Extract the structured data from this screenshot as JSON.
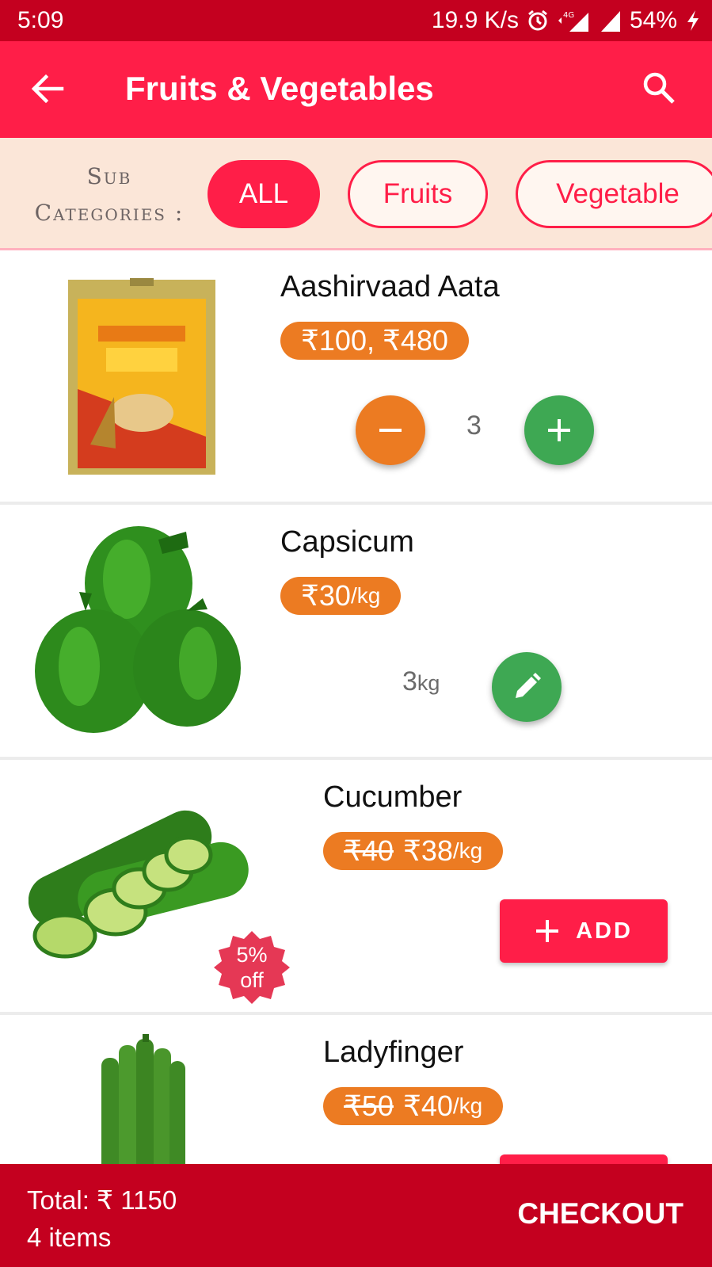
{
  "status": {
    "time": "5:09",
    "network_speed": "19.9 K/s",
    "network_type": "4G",
    "battery": "54%"
  },
  "app_bar": {
    "title": "Fruits & Vegetables",
    "back_icon": "arrow-back-icon",
    "search_icon": "search-icon"
  },
  "subcategories": {
    "label_line1": "Sub",
    "label_line2": "Categories :",
    "chips": [
      "ALL",
      "Fruits",
      "Vegetable"
    ],
    "selected": "ALL"
  },
  "products": [
    {
      "name": "Aashirvaad Aata",
      "price": "₹100, ₹480",
      "quantity": "3",
      "image": "atta-package-image"
    },
    {
      "name": "Capsicum",
      "price": "₹30",
      "unit": "/kg",
      "quantity": "3",
      "quantity_unit": "kg",
      "image": "capsicum-image"
    },
    {
      "name": "Cucumber",
      "old_price": "₹40",
      "price": "₹38",
      "unit": "/kg",
      "discount_line1": "5%",
      "discount_line2": "off",
      "add_label": "ADD",
      "image": "cucumber-image"
    },
    {
      "name": "Ladyfinger",
      "old_price": "₹50",
      "price": "₹40",
      "unit": "/kg",
      "image": "ladyfinger-image"
    }
  ],
  "cart": {
    "total": "Total: ₹ 1150",
    "items": "4 items",
    "checkout_label": "CHECKOUT"
  },
  "colors": {
    "primary": "#ff1e48",
    "status_bar": "#c4001f",
    "price_badge": "#ec7b22",
    "plus_button": "#3ea853",
    "subcat_background": "#fbe6d8"
  }
}
